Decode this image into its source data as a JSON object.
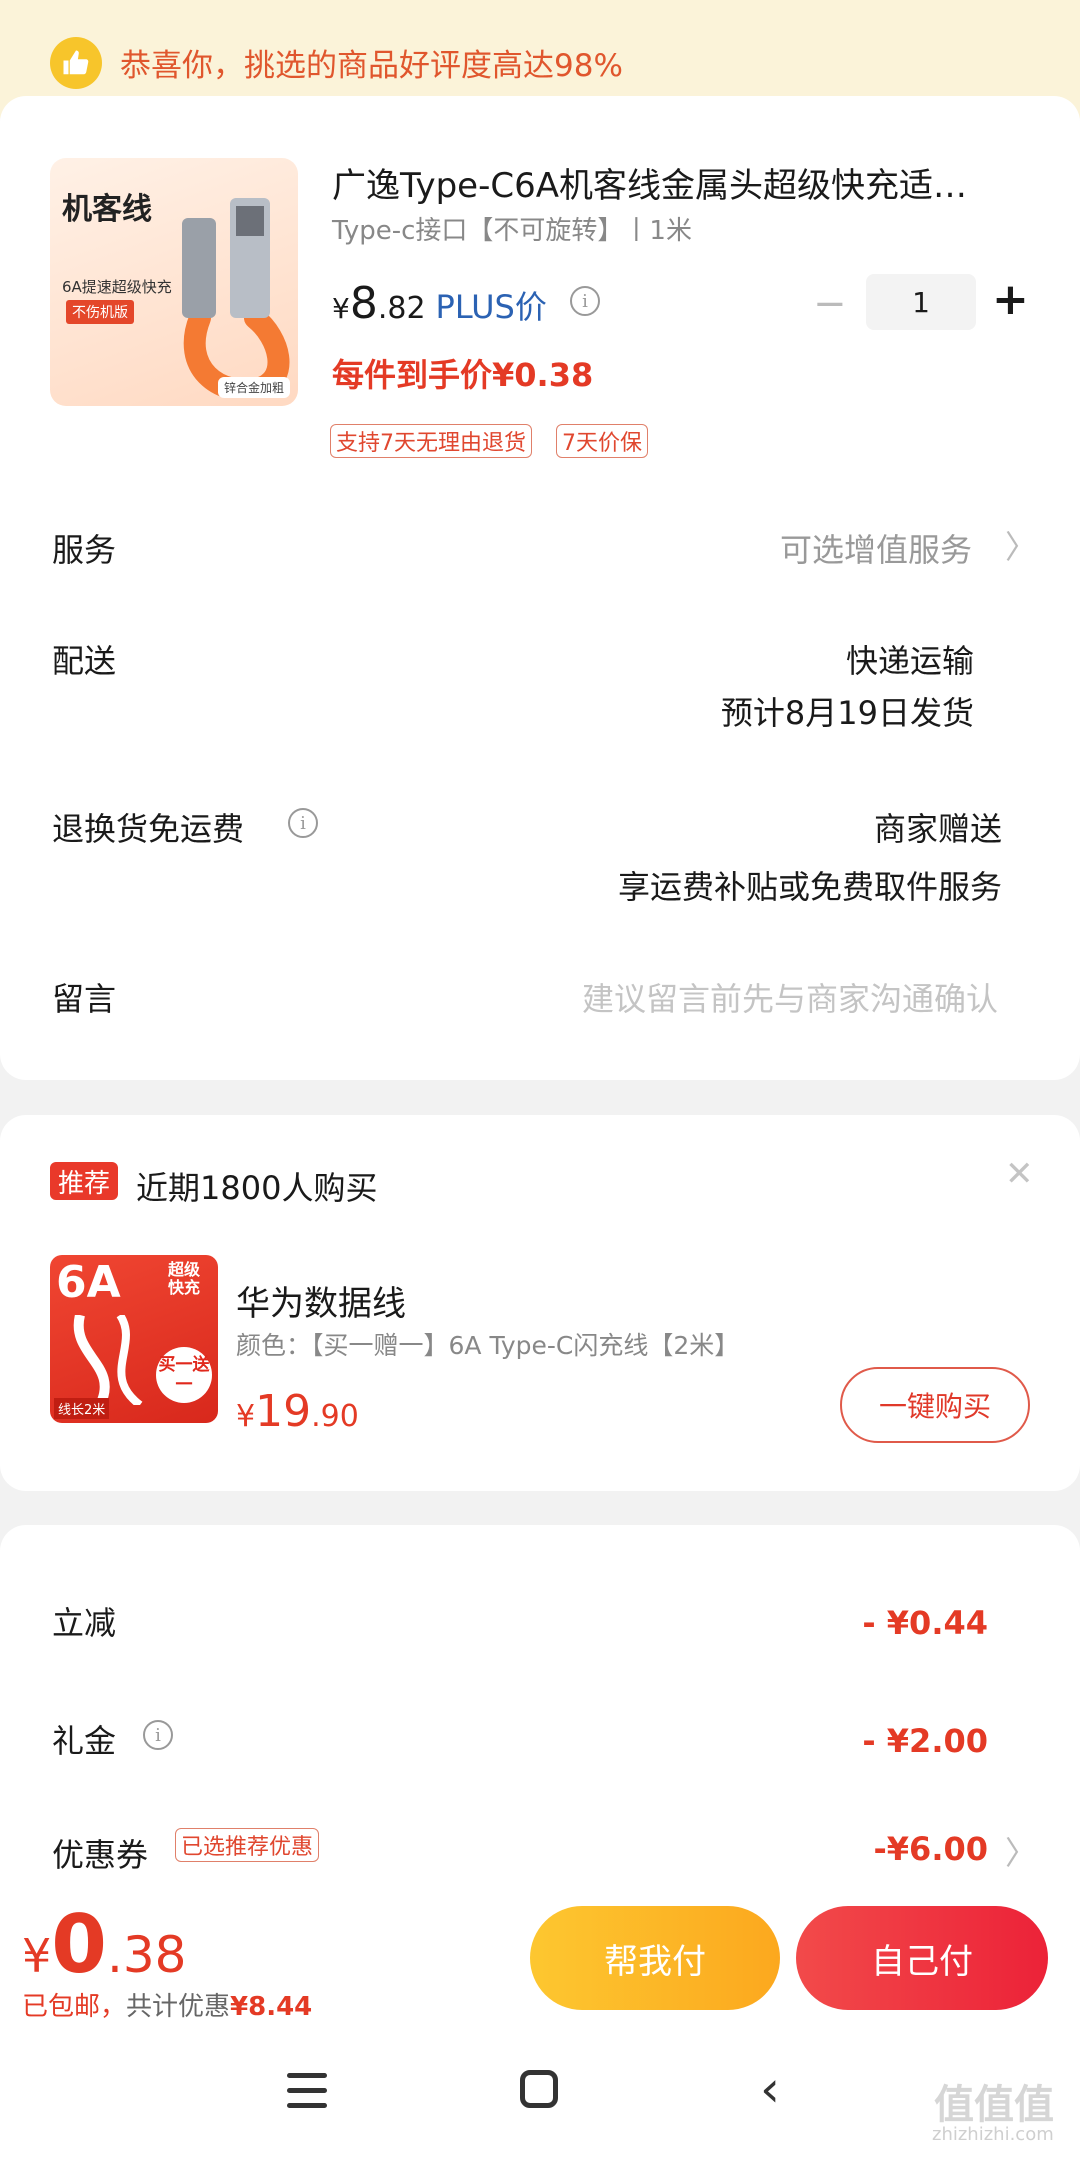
{
  "banner": {
    "text": "恭喜你，挑选的商品好评度高达98%",
    "icon": "thumbs-up-icon"
  },
  "product": {
    "thumb_title": "机客线",
    "thumb_sub": "6A提速超级快充",
    "thumb_tag": "不伤机版",
    "thumb_corner": "锌合金加粗",
    "title": "广逸Type-C6A机客线金属头超级快充适…",
    "spec": "Type-c接口【不可旋转】丨1米",
    "price_symbol": "¥",
    "price_int": "8",
    "price_dec": ".82",
    "plus_label": "PLUS价",
    "final_price": "每件到手价¥0.38",
    "quantity": "1",
    "tags": [
      "支持7天无理由退货",
      "7天价保"
    ]
  },
  "rows": {
    "service_label": "服务",
    "service_value": "可选增值服务",
    "shipping_label": "配送",
    "shipping_method": "快递运输",
    "shipping_eta": "预计8月19日发货",
    "return_label": "退换货免运费",
    "return_value": "商家赠送",
    "return_desc": "享运费补贴或免费取件服务",
    "message_label": "留言",
    "message_placeholder": "建议留言前先与商家沟通确认"
  },
  "recommend": {
    "badge": "推荐",
    "title": "近期1800人购买",
    "product_name": "华为数据线",
    "product_spec": "颜色：【买一赠一】6A Type-C闪充线【2米】",
    "price_symbol": "¥",
    "price_int": "19",
    "price_dec": ".90",
    "buy_label": "一键购买",
    "thumb_big": "6A",
    "thumb_side": "超级快充",
    "thumb_circle": "买一送一",
    "thumb_bottom": "线长2米"
  },
  "discounts": {
    "instant_label": "立减",
    "instant_value": "- ¥0.44",
    "gift_label": "礼金",
    "gift_value": "- ¥2.00",
    "coupon_label": "优惠券",
    "coupon_tag": "已选推荐优惠",
    "coupon_value": "-¥6.00"
  },
  "checkout": {
    "price_symbol": "¥",
    "total_int": "0",
    "total_dec": ".38",
    "shipping_free": "已包邮，",
    "saved_label": "共计优惠",
    "saved_value": "¥8.44",
    "help_pay": "帮我付",
    "self_pay": "自己付"
  },
  "watermark": {
    "main": "值值值",
    "sub": "zhizhizhi.com"
  },
  "colors": {
    "accent_red": "#e43a25",
    "plus_blue": "#2b62b3",
    "yellow_button": "#fdc730",
    "red_button": "#ec2238"
  }
}
